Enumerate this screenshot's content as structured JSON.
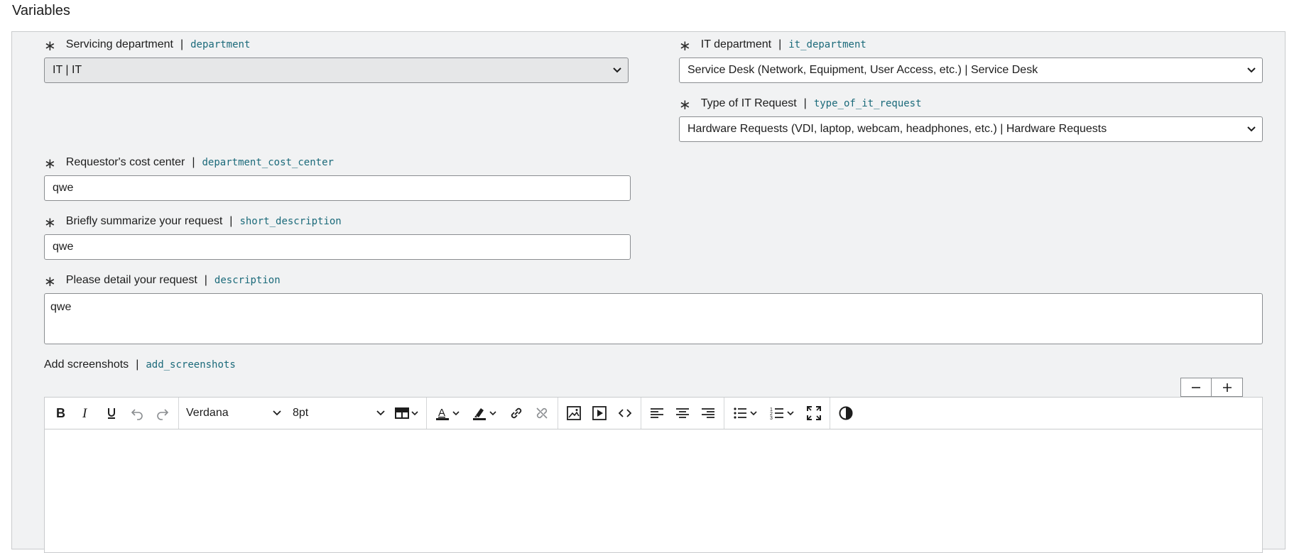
{
  "section_title": "Variables",
  "fields": {
    "servicing_department": {
      "label": "Servicing department",
      "var": "department",
      "value": "IT | IT"
    },
    "it_department": {
      "label": "IT department",
      "var": "it_department",
      "value": "Service Desk (Network, Equipment, User Access, etc.) | Service Desk"
    },
    "type_of_it_request": {
      "label": "Type of IT Request",
      "var": "type_of_it_request",
      "value": "Hardware Requests (VDI, laptop, webcam, headphones, etc.) | Hardware Requests"
    },
    "cost_center": {
      "label": "Requestor's cost center",
      "var": "department_cost_center",
      "value": "qwe"
    },
    "short_description": {
      "label": "Briefly summarize your request",
      "var": "short_description",
      "value": "qwe"
    },
    "description": {
      "label": "Please detail your request",
      "var": "description",
      "value": "qwe"
    },
    "add_screenshots": {
      "label": "Add screenshots",
      "var": "add_screenshots"
    }
  },
  "required_marker": "∗",
  "separator": "|",
  "editor": {
    "font_family": "Verdana",
    "font_size": "8pt"
  },
  "icons": {
    "bold": "bold-icon",
    "italic": "italic-icon",
    "underline": "underline-icon",
    "undo": "undo-icon",
    "redo": "redo-icon",
    "table": "table-icon",
    "text_color": "text-color-icon",
    "highlight": "highlight-icon",
    "link": "link-icon",
    "unlink": "unlink-icon",
    "image": "image-icon",
    "media": "media-icon",
    "code": "code-icon",
    "align_left": "align-left-icon",
    "align_center": "align-center-icon",
    "align_right": "align-right-icon",
    "bullet_list": "bullet-list-icon",
    "numbered_list": "numbered-list-icon",
    "fullscreen": "fullscreen-icon",
    "contrast": "contrast-icon"
  },
  "colors": {
    "panel_bg": "#f1f2f3",
    "var_name": "#1b6a7a",
    "border": "#8a8d90"
  }
}
